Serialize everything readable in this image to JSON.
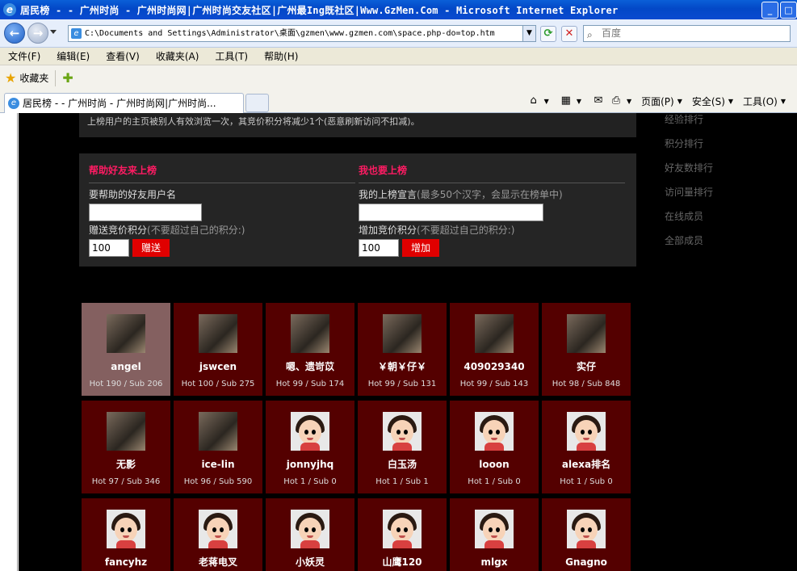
{
  "window": {
    "title": "居民榜 - - 广州时尚 - 广州时尚网|广州时尚交友社区|广州最Ing既社区|Www.GzMen.Com - Microsoft Internet Explorer"
  },
  "address": {
    "url": "C:\\Documents and Settings\\Administrator\\桌面\\gzmen\\www.gzmen.com\\space.php-do=top.htm",
    "search_placeholder": "百度"
  },
  "menu": [
    "文件(F)",
    "编辑(E)",
    "查看(V)",
    "收藏夹(A)",
    "工具(T)",
    "帮助(H)"
  ],
  "favorites": {
    "label": "收藏夹"
  },
  "tab": {
    "label": "居民榜 - - 广州时尚 - 广州时尚网|广州时尚..."
  },
  "commandbar": {
    "page": "页面(P)",
    "safety": "安全(S)",
    "tools": "工具(O)"
  },
  "site": {
    "notice": "上榜用户的主页被别人有效浏览一次，其竞价积分将减少1个(恶意刷新访问不扣减)。",
    "help_friend": {
      "title": "帮助好友来上榜",
      "username_label": "要帮助的好友用户名",
      "credit_label": "赠送竞价积分",
      "credit_hint": "(不要超过自己的积分:)",
      "credit_value": "100",
      "button": "赠送"
    },
    "self_rank": {
      "title": "我也要上榜",
      "slogan_label": "我的上榜宣言",
      "slogan_hint": "(最多50个汉字，会显示在榜单中)",
      "credit_label": "增加竞价积分",
      "credit_hint": "(不要超过自己的积分:)",
      "credit_value": "100",
      "button": "增加"
    },
    "sidenav": [
      "经验排行",
      "积分排行",
      "好友数排行",
      "访问量排行",
      "在线成员",
      "全部成员"
    ],
    "members": [
      {
        "name": "angel",
        "stats": "Hot 190 / Sub 206",
        "avatar": "photo"
      },
      {
        "name": "jswcen",
        "stats": "Hot 100 / Sub 275",
        "avatar": "photo"
      },
      {
        "name": "嗯、遗岢苡",
        "stats": "Hot 99 / Sub 174",
        "avatar": "photo"
      },
      {
        "name": "￥朝￥仔￥",
        "stats": "Hot 99 / Sub 131",
        "avatar": "photo"
      },
      {
        "name": "409029340",
        "stats": "Hot 99 / Sub 143",
        "avatar": "photo"
      },
      {
        "name": "实仔",
        "stats": "Hot 98 / Sub 848",
        "avatar": "photo"
      },
      {
        "name": "无影",
        "stats": "Hot 97 / Sub 346",
        "avatar": "photo"
      },
      {
        "name": "ice-lin",
        "stats": "Hot 96 / Sub 590",
        "avatar": "photo"
      },
      {
        "name": "jonnyjhq",
        "stats": "Hot 1 / Sub 0",
        "avatar": "default-avatar"
      },
      {
        "name": "白玉汤",
        "stats": "Hot 1 / Sub 1",
        "avatar": "default-avatar"
      },
      {
        "name": "looon",
        "stats": "Hot 1 / Sub 0",
        "avatar": "default-avatar"
      },
      {
        "name": "alexa排名",
        "stats": "Hot 1 / Sub 0",
        "avatar": "default-avatar"
      },
      {
        "name": "fancyhz",
        "stats": "",
        "avatar": "default-avatar"
      },
      {
        "name": "老蒋电叉",
        "stats": "",
        "avatar": "default-avatar"
      },
      {
        "name": "小妖灵",
        "stats": "",
        "avatar": "default-avatar"
      },
      {
        "name": "山鹰120",
        "stats": "",
        "avatar": "default-avatar"
      },
      {
        "name": "mlgx",
        "stats": "",
        "avatar": "default-avatar"
      },
      {
        "name": "Gnagno",
        "stats": "",
        "avatar": "default-avatar"
      }
    ],
    "highlight_color": "#846060",
    "card_color": "#540000",
    "accent_color": "#ff1b63"
  }
}
